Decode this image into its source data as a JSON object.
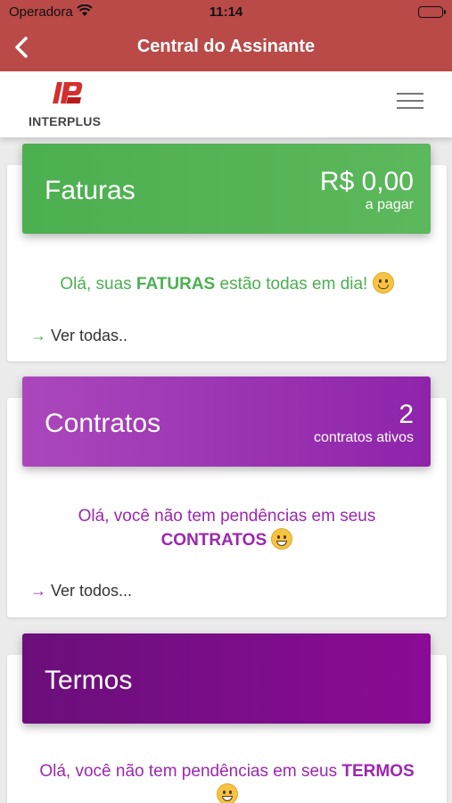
{
  "status_bar": {
    "carrier": "Operadora",
    "time": "11:14"
  },
  "nav": {
    "title": "Central do Assinante",
    "back_icon": "chevron-left-icon"
  },
  "brand": {
    "logo_text": "INTERPLUS",
    "menu_icon": "hamburger-icon"
  },
  "cards": {
    "faturas": {
      "title": "Faturas",
      "value": "R$ 0,00",
      "subtitle": "a pagar",
      "msg_before": "Olá, suas ",
      "msg_bold": "FATURAS",
      "msg_after": " estão todas em dia! ",
      "emoji": "winking-face-icon",
      "link": "Ver todas..",
      "color": "#4caf50"
    },
    "contratos": {
      "title": "Contratos",
      "value": "2",
      "subtitle": "contratos ativos",
      "msg_before": "Olá, você não tem pendências em seus ",
      "msg_bold": "CONTRATOS",
      "emoji": "grinning-face-icon",
      "link": "Ver todos...",
      "color": "#9c27b0"
    },
    "termos": {
      "title": "Termos",
      "msg_before": "Olá, você não tem pendências em seus ",
      "msg_bold": "TERMOS",
      "emoji": "grinning-face-icon",
      "color": "#8b0b96"
    }
  },
  "colors": {
    "header": "#b94a48",
    "accent_green": "#4caf50",
    "accent_purple": "#9c27b0"
  }
}
